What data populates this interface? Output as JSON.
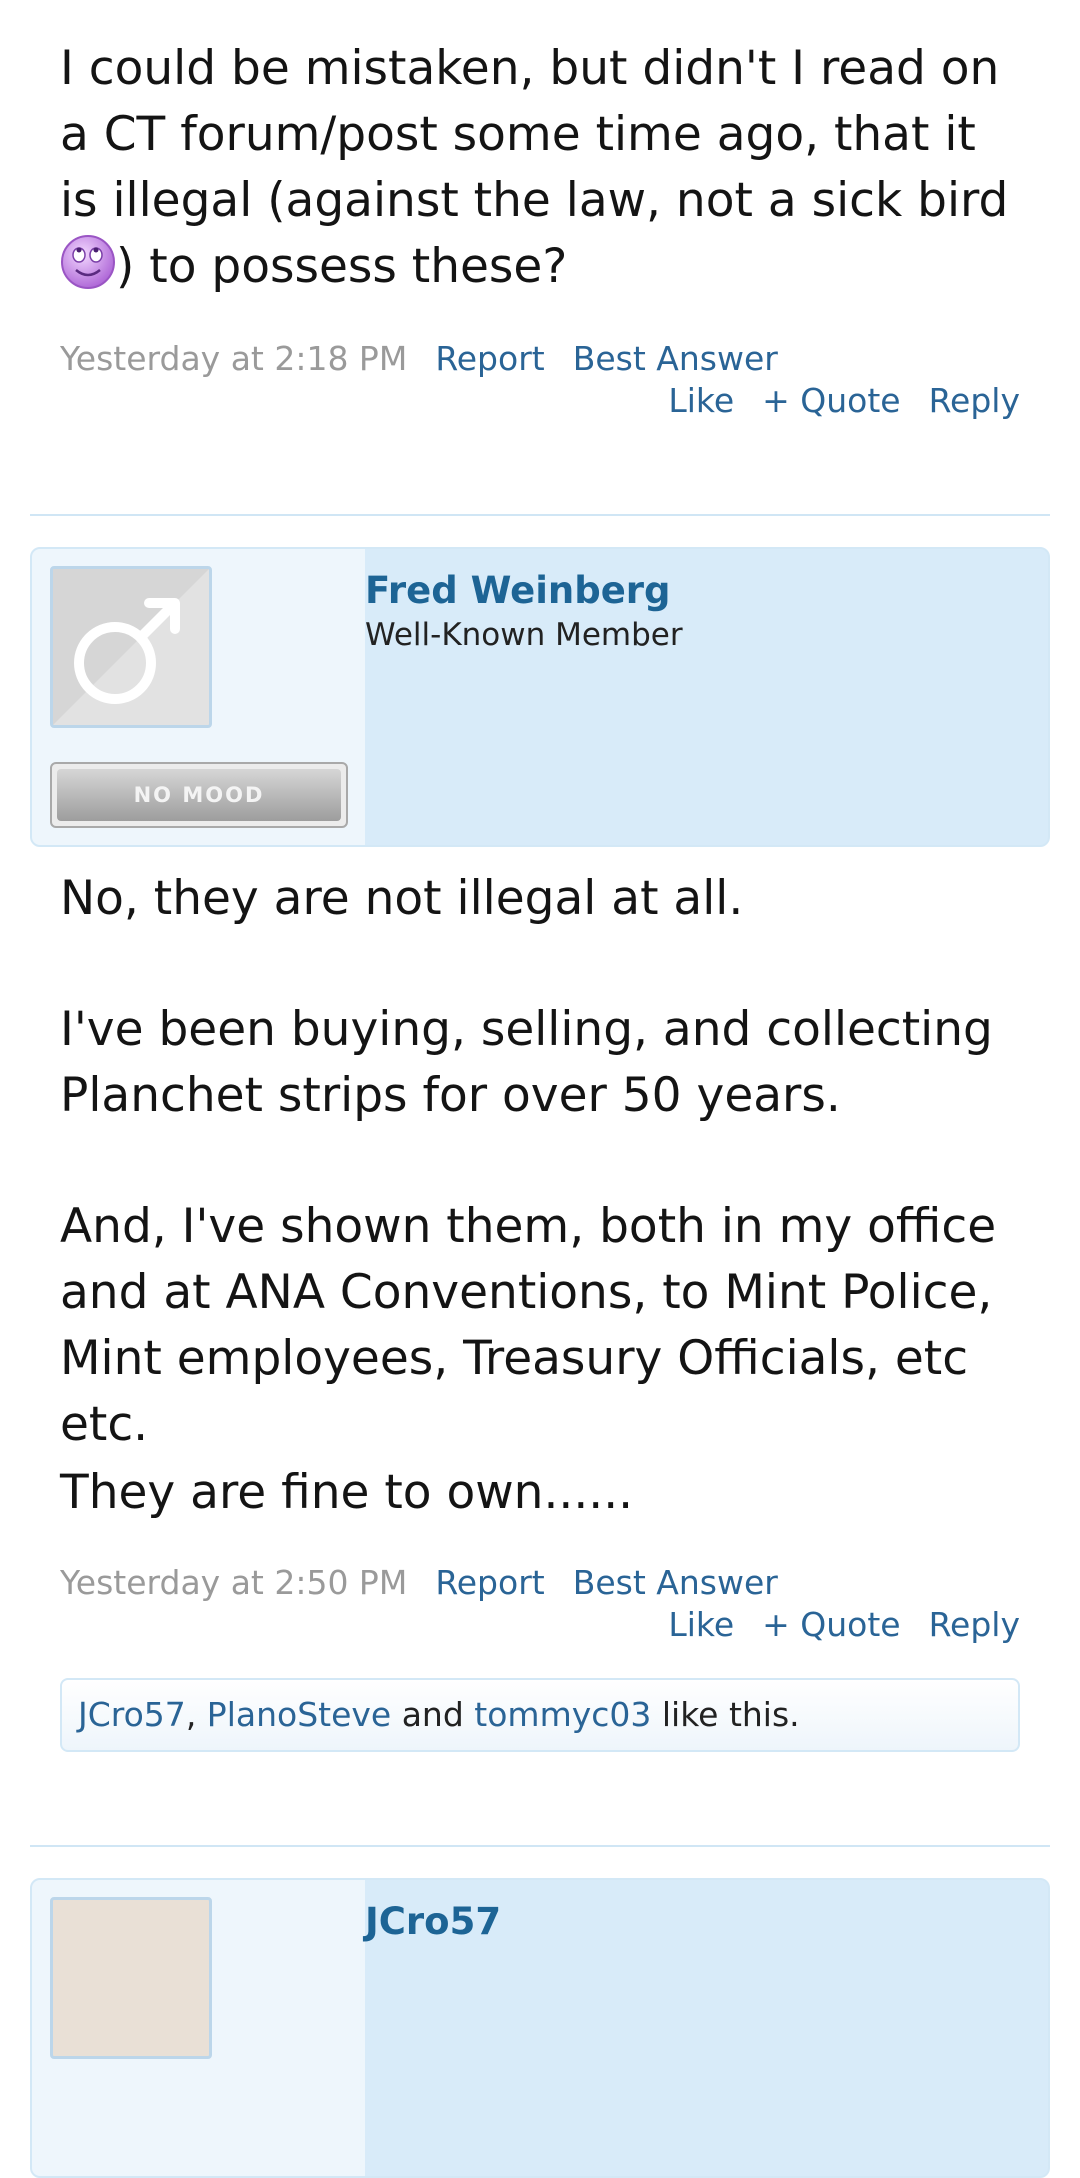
{
  "post1": {
    "text_a": "I could be mistaken, but didn't I read on a CT forum/post some time ago, that it is illegal (against the law, not a sick bird ",
    "text_b": ") to possess these?",
    "smiley_icon": "rolling-eyes-smiley",
    "date": "Yesterday at 2:18 PM",
    "report": "Report",
    "best_answer": "Best Answer",
    "like": "Like",
    "quote": "+ Quote",
    "reply": "Reply"
  },
  "post2": {
    "username": "Fred Weinberg",
    "user_title": "Well-Known Member",
    "avatar_icon": "male-symbol-icon",
    "mood": "NO MOOD",
    "paragraphs": [
      "No, they are not illegal at all.",
      "I've been buying, selling, and collecting Planchet strips for over 50 years.",
      "And, I've shown them, both in my office and at ANA Conventions, to Mint Police, Mint employees, Treasury Officials, etc etc.",
      "They are fine to own......"
    ],
    "date": "Yesterday at 2:50 PM",
    "report": "Report",
    "best_answer": "Best Answer",
    "like": "Like",
    "quote": "+ Quote",
    "reply": "Reply",
    "likes": {
      "user1": "JCro57",
      "sep1": ", ",
      "user2": "PlanoSteve",
      "sep2": " and ",
      "user3": "tommyc03",
      "suffix": " like this."
    }
  },
  "post3": {
    "username": "JCro57"
  }
}
